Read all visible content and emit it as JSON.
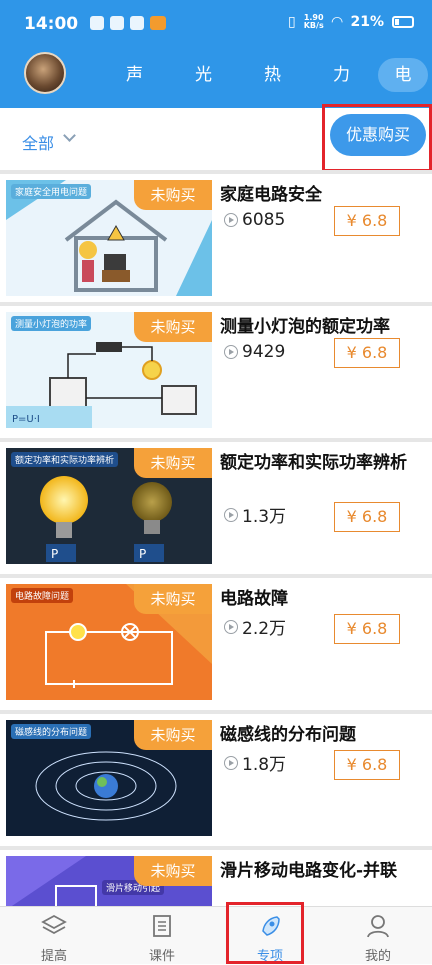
{
  "status_bar": {
    "time": "14:00",
    "net_speed_value": "1.90",
    "net_speed_unit": "KB/s",
    "battery": "21%"
  },
  "topic_tabs": [
    {
      "label": "声"
    },
    {
      "label": "光"
    },
    {
      "label": "热"
    },
    {
      "label": "力"
    },
    {
      "label": "电",
      "active": true
    }
  ],
  "filter": {
    "label": "全部"
  },
  "promo_button": {
    "label": "优惠购买"
  },
  "course_badge": "未购买",
  "courses": [
    {
      "thumb_caption": "家庭安全用电问题",
      "title": "家庭电路安全",
      "views": "6085",
      "price": "¥ 6.8"
    },
    {
      "thumb_caption": "测量小灯泡的功率",
      "title": "测量小灯泡的额定功率",
      "views": "9429",
      "price": "¥ 6.8"
    },
    {
      "thumb_caption": "额定功率和实际功率辨析",
      "title": "额定功率和实际功率辨析",
      "views": "1.3万",
      "price": "¥ 6.8"
    },
    {
      "thumb_caption": "电路故障问题",
      "title": "电路故障",
      "views": "2.2万",
      "price": "¥ 6.8"
    },
    {
      "thumb_caption": "磁感线的分布问题",
      "title": "磁感线的分布问题",
      "views": "1.8万",
      "price": "¥ 6.8"
    },
    {
      "thumb_caption": "滑片移动引起",
      "title": "滑片移动电路变化-并联",
      "views": "",
      "price": ""
    }
  ],
  "bottom_nav": [
    {
      "label": "提高",
      "icon": "layers-icon"
    },
    {
      "label": "课件",
      "icon": "document-icon"
    },
    {
      "label": "专项",
      "icon": "rocket-icon",
      "active": true
    },
    {
      "label": "我的",
      "icon": "user-icon"
    }
  ],
  "colors": {
    "primary": "#2f96e8",
    "price": "#e88a2f",
    "badge": "#f5a13a",
    "highlight": "#e3242b"
  }
}
